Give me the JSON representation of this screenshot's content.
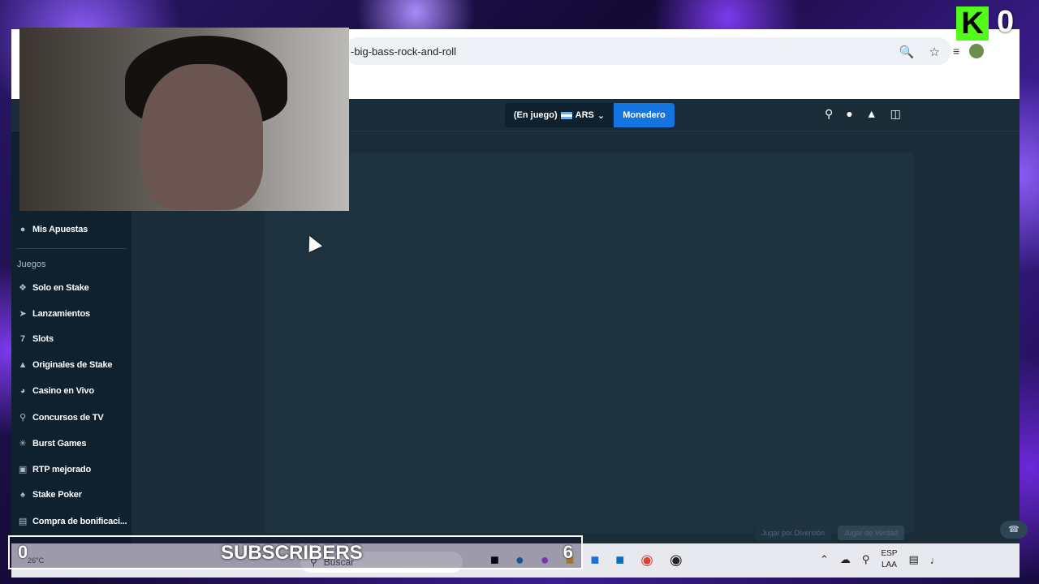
{
  "browser": {
    "url": "-big-bass-rock-and-roll"
  },
  "site": {
    "balance_label": "(En juego)",
    "currency": "ARS",
    "wallet_button": "Monedero",
    "sidebar": {
      "my_bets": "Mis Apuestas",
      "section_games": "Juegos",
      "items": [
        {
          "label": "Solo en Stake",
          "icon": "stake-icon"
        },
        {
          "label": "Lanzamientos",
          "icon": "rocket-icon"
        },
        {
          "label": "Slots",
          "icon": "slots-icon"
        },
        {
          "label": "Originales de Stake",
          "icon": "fire-icon"
        },
        {
          "label": "Casino en Vivo",
          "icon": "headset-icon"
        },
        {
          "label": "Concursos de TV",
          "icon": "microphone-icon"
        },
        {
          "label": "Burst Games",
          "icon": "burst-icon"
        },
        {
          "label": "RTP mejorado",
          "icon": "rtp-icon"
        },
        {
          "label": "Stake Poker",
          "icon": "poker-icon"
        },
        {
          "label": "Compra de bonificaci...",
          "icon": "bonus-icon"
        }
      ]
    },
    "game_footer": {
      "demo": "Jugar por Diversión",
      "real": "Jugar de Verdad"
    }
  },
  "taskbar": {
    "search_placeholder": "Buscar",
    "weather": "26°C",
    "lang_top": "ESP",
    "lang_bottom": "LAA"
  },
  "overlay": {
    "subscribers_title": "SUBSCRIBERS",
    "left_count": "0",
    "right_count": "6",
    "kick_logo": "K",
    "kick_count": "0"
  }
}
